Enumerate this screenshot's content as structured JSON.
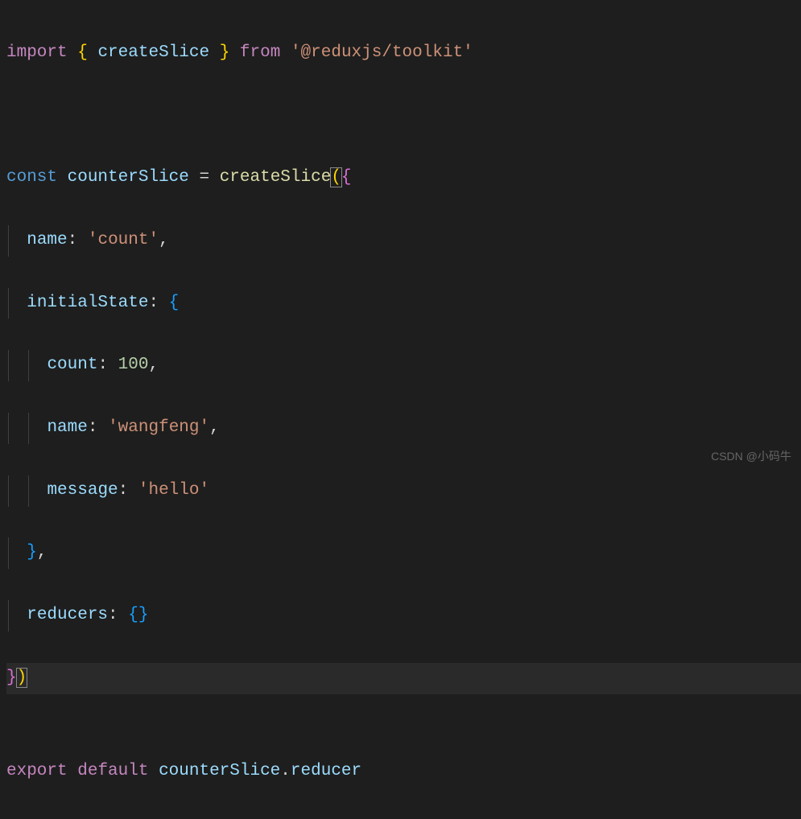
{
  "code": {
    "line1": {
      "import": "import",
      "brace_open": "{",
      "createSlice": "createSlice",
      "brace_close": "}",
      "from": "from",
      "module": "'@reduxjs/toolkit'"
    },
    "line3": {
      "const": "const",
      "varName": "counterSlice",
      "equals": "=",
      "funcName": "createSlice",
      "paren_open": "(",
      "brace_open": "{"
    },
    "line4": {
      "prop": "name",
      "colon": ":",
      "value": "'count'",
      "comma": ","
    },
    "line5": {
      "prop": "initialState",
      "colon": ":",
      "brace": "{"
    },
    "line6": {
      "prop": "count",
      "colon": ":",
      "value": "100",
      "comma": ","
    },
    "line7": {
      "prop": "name",
      "colon": ":",
      "value": "'wangfeng'",
      "comma": ","
    },
    "line8": {
      "prop": "message",
      "colon": ":",
      "value": "'hello'"
    },
    "line9": {
      "brace": "}",
      "comma": ","
    },
    "line10": {
      "prop": "reducers",
      "colon": ":",
      "brace_open": "{",
      "brace_close": "}"
    },
    "line11": {
      "brace": "}",
      "paren": ")"
    },
    "line13": {
      "export": "export",
      "default": "default",
      "varName": "counterSlice",
      "dot": ".",
      "prop": "reducer"
    }
  },
  "watermark": "CSDN @小码牛"
}
